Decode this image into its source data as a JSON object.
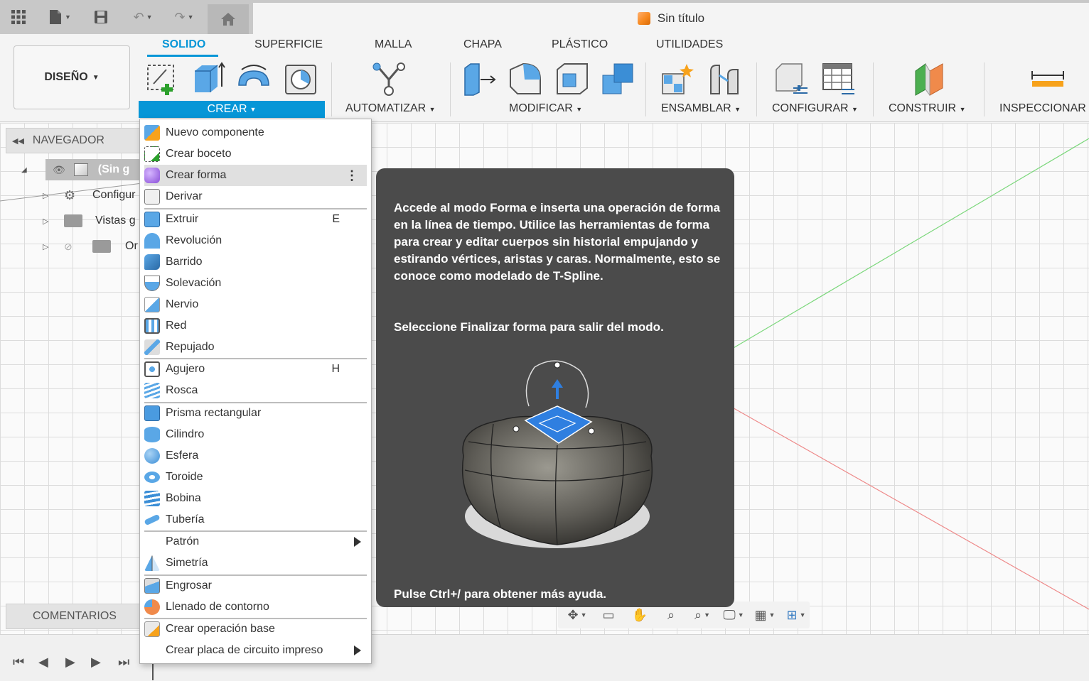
{
  "app": {
    "document_title": "Sin título"
  },
  "workspace": {
    "design_label": "DISEÑO"
  },
  "tabs": [
    "SOLIDO",
    "SUPERFICIE",
    "MALLA",
    "CHAPA",
    "PLÁSTICO",
    "UTILIDADES"
  ],
  "ribbon_groups": {
    "crear": "CREAR",
    "automatizar": "AUTOMATIZAR",
    "modificar": "MODIFICAR",
    "ensamblar": "ENSAMBLAR",
    "configurar": "CONFIGURAR",
    "construir": "CONSTRUIR",
    "inspeccionar": "INSPECCIONAR"
  },
  "browser": {
    "title": "NAVEGADOR",
    "root": "(Sin g",
    "items": [
      "Configur",
      "Vistas g",
      "Or"
    ]
  },
  "comments_label": "COMENTARIOS",
  "menu": {
    "items": [
      {
        "label": "Nuevo componente",
        "icon": "new-component-icon",
        "shortcut": ""
      },
      {
        "label": "Crear boceto",
        "icon": "sketch-icon",
        "shortcut": ""
      },
      {
        "label": "Crear forma",
        "icon": "form-icon",
        "shortcut": ""
      },
      {
        "label": "Derivar",
        "icon": "derive-icon",
        "shortcut": ""
      },
      {
        "label": "Extruir",
        "icon": "extrude-icon",
        "shortcut": "E"
      },
      {
        "label": "Revolución",
        "icon": "revolve-icon",
        "shortcut": ""
      },
      {
        "label": "Barrido",
        "icon": "sweep-icon",
        "shortcut": ""
      },
      {
        "label": "Solevación",
        "icon": "loft-icon",
        "shortcut": ""
      },
      {
        "label": "Nervio",
        "icon": "rib-icon",
        "shortcut": ""
      },
      {
        "label": "Red",
        "icon": "web-icon",
        "shortcut": ""
      },
      {
        "label": "Repujado",
        "icon": "emboss-icon",
        "shortcut": ""
      },
      {
        "label": "Agujero",
        "icon": "hole-icon",
        "shortcut": "H"
      },
      {
        "label": "Rosca",
        "icon": "thread-icon",
        "shortcut": ""
      },
      {
        "label": "Prisma rectangular",
        "icon": "box-icon",
        "shortcut": ""
      },
      {
        "label": "Cilindro",
        "icon": "cylinder-icon",
        "shortcut": ""
      },
      {
        "label": "Esfera",
        "icon": "sphere-icon",
        "shortcut": ""
      },
      {
        "label": "Toroide",
        "icon": "torus-icon",
        "shortcut": ""
      },
      {
        "label": "Bobina",
        "icon": "coil-icon",
        "shortcut": ""
      },
      {
        "label": "Tubería",
        "icon": "pipe-icon",
        "shortcut": ""
      },
      {
        "label": "Patrón",
        "icon": "",
        "shortcut": ""
      },
      {
        "label": "Simetría",
        "icon": "mirror-icon",
        "shortcut": ""
      },
      {
        "label": "Engrosar",
        "icon": "thicken-icon",
        "shortcut": ""
      },
      {
        "label": "Llenado de contorno",
        "icon": "boundary-fill-icon",
        "shortcut": ""
      },
      {
        "label": "Crear operación base",
        "icon": "base-feature-icon",
        "shortcut": ""
      },
      {
        "label": "Crear placa de circuito impreso",
        "icon": "",
        "shortcut": ""
      }
    ]
  },
  "tooltip": {
    "body": "Accede al modo Forma e inserta una operación de forma en la línea de tiempo. Utilice las herramientas de forma para crear y editar cuerpos sin historial empujando y estirando vértices, aristas y caras. Normalmente, esto se conoce como modelado de T-Spline.",
    "exit": "Seleccione Finalizar forma para salir del modo.",
    "help": "Pulse Ctrl+/ para obtener más ayuda."
  },
  "colors": {
    "accent": "#0696d7",
    "tooltip_bg": "#4b4b4b"
  }
}
